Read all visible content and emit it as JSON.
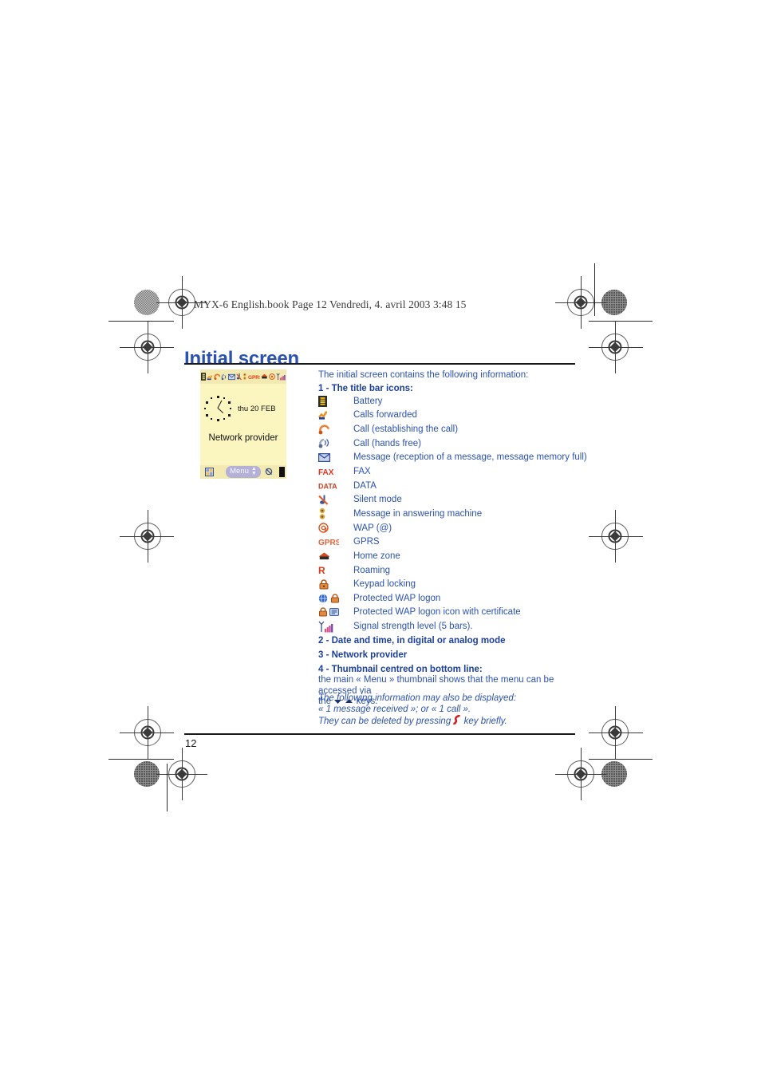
{
  "page": {
    "header_line": "MYX-6 English.book  Page 12  Vendredi, 4. avril 2003  3:48 15",
    "title": "Initial screen",
    "folio": "12"
  },
  "colors": {
    "heading_blue": "#2b52ad",
    "body_blue": "#2b52ad",
    "section_blue": "#1b3f9b",
    "lcd_background": "#fbf5c0",
    "lcd_bar": "#f2eab0",
    "menu_pill": "#b5b0d8",
    "rule": "#1a1a1a"
  },
  "phone_screen": {
    "titlebar_icons": [
      "battery-icon",
      "calls-forwarded-icon",
      "call-establishing-icon",
      "call-handsfree-icon",
      "message-icon",
      "silent-mode-icon",
      "answering-machine-icon",
      "gprs-icon",
      "home-zone-icon",
      "wap-icon",
      "signal-strength-icon"
    ],
    "clock": {
      "icon": "analog-clock-icon"
    },
    "date": "thu 20 FEB",
    "network_provider": "Network provider",
    "bottom_bar": {
      "left_icon": "thumbnail-icon",
      "menu_label": "Menu",
      "menu_updown": "updown-arrows-icon",
      "right_icon": "silent-ringer-icon"
    }
  },
  "content": {
    "intro": "The initial screen contains the following information:",
    "section1_title": "1 - The title bar icons:",
    "icons": [
      {
        "icon": "battery-icon",
        "label": "Battery"
      },
      {
        "icon": "calls-forwarded-icon",
        "label": "Calls forwarded"
      },
      {
        "icon": "call-establishing-icon",
        "label": "Call (establishing the call)"
      },
      {
        "icon": "call-handsfree-icon",
        "label": "Call (hands free)"
      },
      {
        "icon": "message-envelope-icon",
        "label": "Message (reception of a message, message memory full)"
      },
      {
        "icon": "fax-icon",
        "label": "FAX"
      },
      {
        "icon": "data-icon",
        "label": "DATA"
      },
      {
        "icon": "silent-mode-icon",
        "label": "Silent mode"
      },
      {
        "icon": "answering-machine-icon",
        "label": "Message in answering machine"
      },
      {
        "icon": "wap-at-icon",
        "label": "WAP (@)"
      },
      {
        "icon": "gprs-icon",
        "label": "GPRS"
      },
      {
        "icon": "home-zone-icon",
        "label": "Home zone"
      },
      {
        "icon": "roaming-icon",
        "label": "Roaming"
      },
      {
        "icon": "keypad-lock-icon",
        "label": "Keypad locking"
      },
      {
        "icon": "protected-wap-logon-icon",
        "label": "Protected WAP logon"
      },
      {
        "icon": "protected-wap-certificate-icon",
        "label": "Protected WAP logon icon with certificate"
      },
      {
        "icon": "signal-strength-icon",
        "label": "Signal strength level (5 bars)."
      }
    ],
    "section2_title": "2 - Date and time, in digital or analog mode",
    "section3_title": "3 - Network provider",
    "section4_title": "4 - Thumbnail centred on bottom line:",
    "para_line1": "the main « Menu » thumbnail shows that the menu can be accessed via",
    "para_line2_pre": "the",
    "para_line2_post": "keys.",
    "italic_line1": "The following information may also be displayed:",
    "italic_line2": "« 1 message received »; or « 1 call ».",
    "italic_line3_pre": "They can be deleted by pressing",
    "italic_line3_post": "key briefly."
  }
}
